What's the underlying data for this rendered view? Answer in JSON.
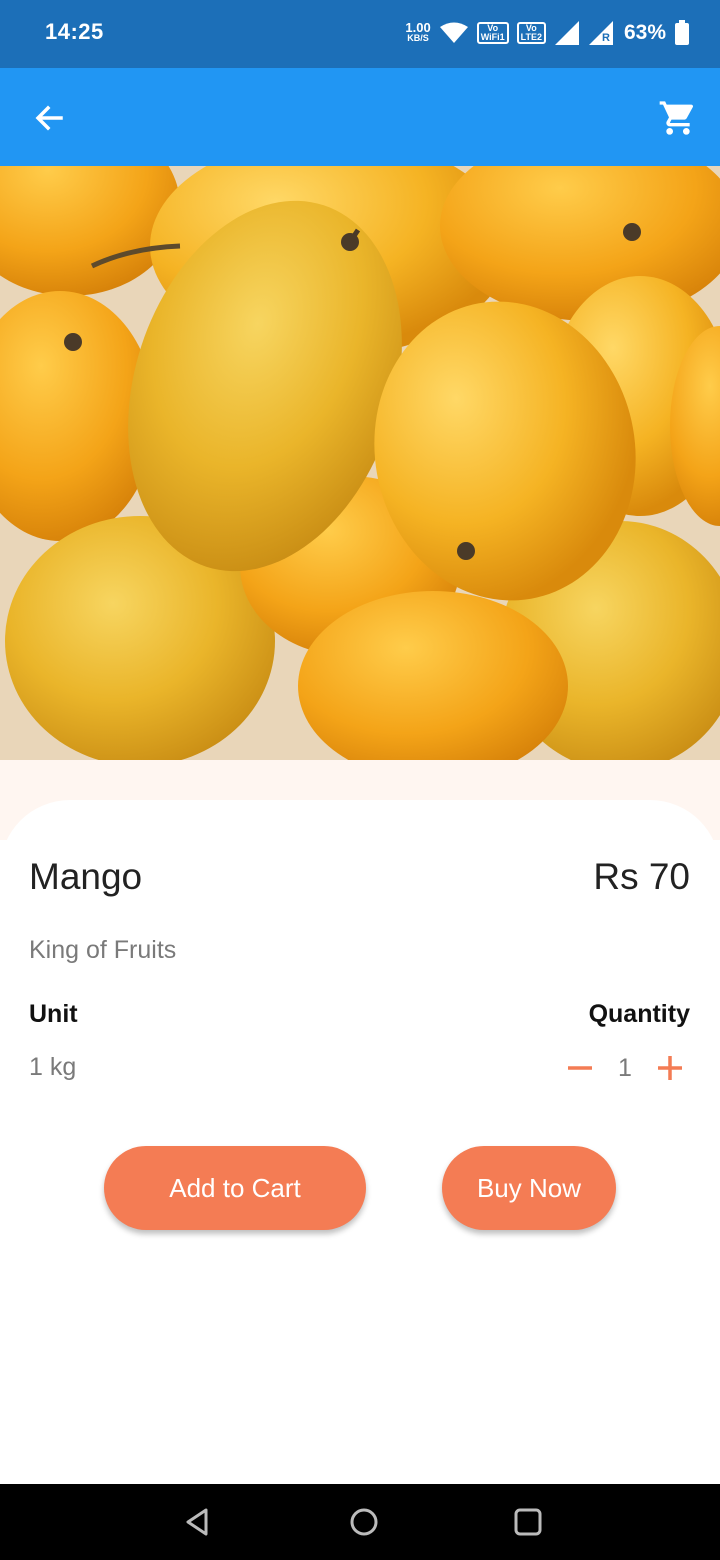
{
  "status_bar": {
    "time": "14:25",
    "net_speed_value": "1.00",
    "net_speed_unit": "KB/S",
    "badge_wifi_top": "Vo",
    "badge_wifi_bottom": "WiFi1",
    "badge_lte_top": "Vo",
    "badge_lte_bottom": "LTE2",
    "roaming": "R",
    "battery": "63%"
  },
  "app_bar": {
    "back_icon": "arrow-left-icon",
    "cart_icon": "shopping-cart-icon",
    "background": "#2196f3"
  },
  "product": {
    "name": "Mango",
    "price": "Rs 70",
    "tagline": "King of Fruits",
    "unit_label": "Unit",
    "unit_value": "1 kg",
    "quantity_label": "Quantity",
    "quantity_value": "1"
  },
  "actions": {
    "add_to_cart": "Add to Cart",
    "buy_now": "Buy Now",
    "accent": "#f47c54"
  },
  "nav_bar": {
    "back": "triangle-back-icon",
    "home": "circle-home-icon",
    "recents": "square-recents-icon"
  }
}
